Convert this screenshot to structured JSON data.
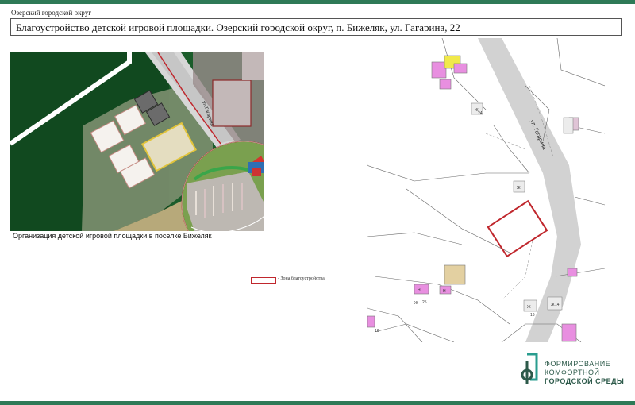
{
  "header": {
    "organization": "Озерский городской округ",
    "title": "Благоустройство детской игровой площадки. Озерский городской округ, п. Бижеляк, ул. Гагарина, 22"
  },
  "plan": {
    "street_label": "ул.Гагарина",
    "caption": "Организация детской игровой площадки в поселке Бижеляк"
  },
  "legend": {
    "zone_label": "- Зона благоустройства"
  },
  "map": {
    "street_label": "ул. Гагарина",
    "house_numbers": [
      "24",
      "25",
      "14",
      "16",
      "16"
    ],
    "building_marks": [
      "Ж",
      "Ж",
      "Ж",
      "Н",
      "Н",
      "Ж",
      "Ж"
    ]
  },
  "logo": {
    "line1": "ФОРМИРОВАНИЕ",
    "line2": "КОМФОРТНОЙ",
    "line3": "ГОРОДСКОЙ СРЕДЫ"
  },
  "colors": {
    "brand_green": "#2e7a57",
    "zone_red": "#c0272d"
  }
}
